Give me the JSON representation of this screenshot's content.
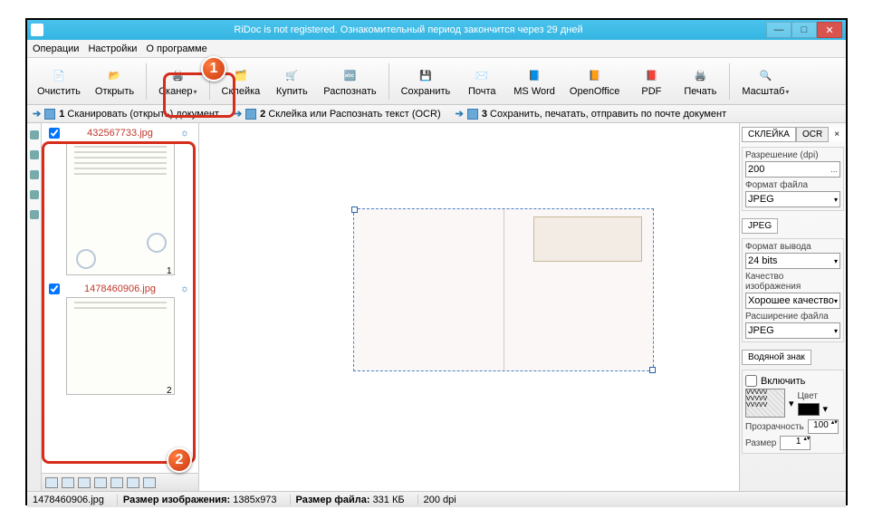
{
  "title": "RiDoc is not registered. Ознакомительный период закончится через 29 дней",
  "menu": {
    "ops": "Операции",
    "settings": "Настройки",
    "about": "О программе"
  },
  "toolbar": {
    "clear": "Очистить",
    "open": "Открыть",
    "scanner": "Сканер",
    "glue": "Склейка",
    "buy": "Купить",
    "ocr": "Распознать",
    "save": "Сохранить",
    "mail": "Почта",
    "word": "MS Word",
    "oo": "OpenOffice",
    "pdf": "PDF",
    "print": "Печать",
    "zoom": "Масштаб"
  },
  "hints": {
    "s1n": "1",
    "s1": "Сканировать (открыть) документ",
    "s2n": "2",
    "s2": "Склейка или Распознать текст (OCR)",
    "s3n": "3",
    "s3": "Сохранить, печатать, отправить по почте документ"
  },
  "thumbs": {
    "t1": {
      "name": "432567733.jpg",
      "idx": "1"
    },
    "t2": {
      "name": "1478460906.jpg",
      "idx": "2"
    }
  },
  "right": {
    "tab_glue": "СКЛЕЙКА",
    "tab_ocr": "OCR",
    "close": "×",
    "res_label": "Разрешение (dpi)",
    "res_value": "200",
    "fmt_label": "Формат файла",
    "fmt_value": "JPEG",
    "jpeg_tab": "JPEG",
    "out_label": "Формат вывода",
    "out_value": "24 bits",
    "qual_label": "Качество изображения",
    "qual_value": "Хорошее качество",
    "ext_label": "Расширение файла",
    "ext_value": "JPEG",
    "wm_tab": "Водяной знак",
    "wm_enable": "Включить",
    "wm_color": "Цвет",
    "wm_opacity_label": "Прозрачность",
    "wm_opacity": "100",
    "wm_size_label": "Размер",
    "wm_size": "1"
  },
  "status": {
    "file": "1478460906.jpg",
    "dim_label": "Размер изображения:",
    "dim": "1385x973",
    "size_label": "Размер файла:",
    "size": "331 КБ",
    "dpi": "200 dpi"
  },
  "callouts": {
    "b1": "1",
    "b2": "2"
  }
}
